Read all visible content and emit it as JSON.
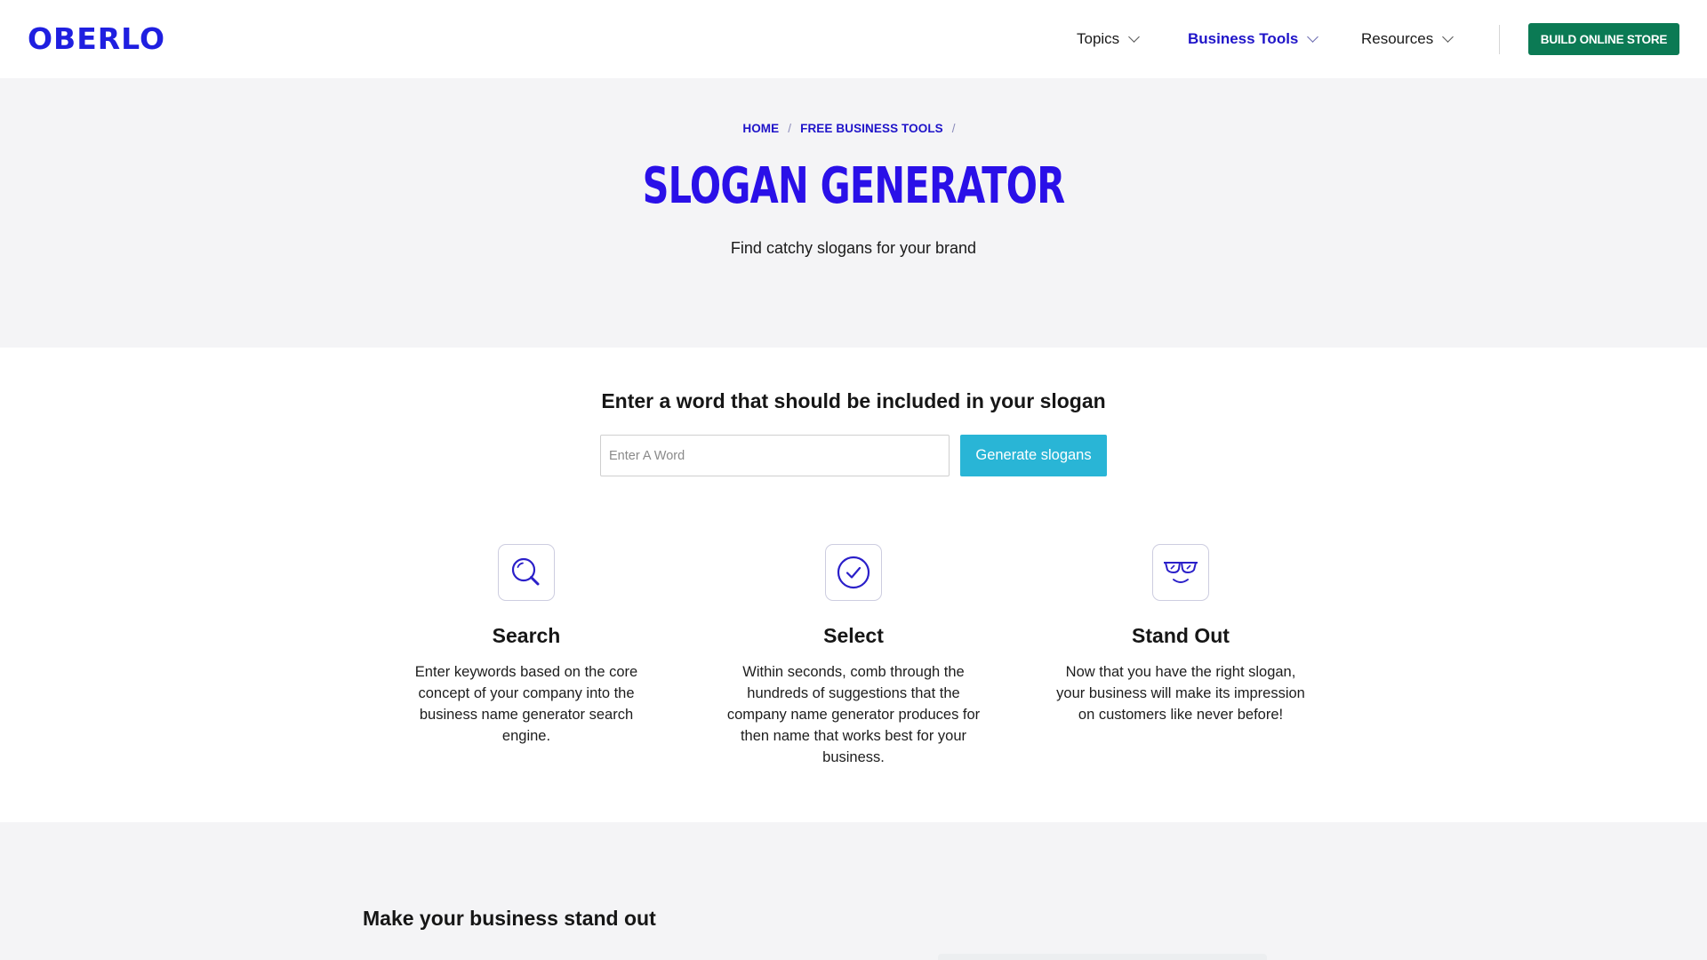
{
  "header": {
    "logo": "OBERLO",
    "nav": [
      {
        "label": "Topics",
        "active": false
      },
      {
        "label": "Business Tools",
        "active": true
      },
      {
        "label": "Resources",
        "active": false
      }
    ],
    "cta_label": "BUILD ONLINE STORE"
  },
  "hero": {
    "breadcrumb": [
      "HOME",
      "FREE BUSINESS TOOLS"
    ],
    "title": "SLOGAN GENERATOR",
    "subtitle": "Find catchy slogans for your brand"
  },
  "generator": {
    "heading": "Enter a word that should be included in your slogan",
    "input_value": "",
    "input_placeholder": "Enter A Word",
    "button_label": "Generate slogans"
  },
  "features": [
    {
      "icon": "magnifier-icon",
      "title": "Search",
      "description": "Enter keywords based on the core concept of your company into the business name generator search engine."
    },
    {
      "icon": "check-circle-icon",
      "title": "Select",
      "description": "Within seconds, comb through the hundreds of suggestions that the company name generator produces for then name that works best for your business."
    },
    {
      "icon": "sunglasses-face-icon",
      "title": "Stand Out",
      "description": "Now that you have the right slogan, your business will make its impression on customers like never before!"
    }
  ],
  "bottom": {
    "heading": "Make your business stand out"
  },
  "colors": {
    "brand": "#1f1fe0",
    "accent_title": "#2a10e8",
    "cta_green": "#0b7a54",
    "button_blue": "#29b5d6",
    "hero_bg": "#f4f4f6"
  }
}
